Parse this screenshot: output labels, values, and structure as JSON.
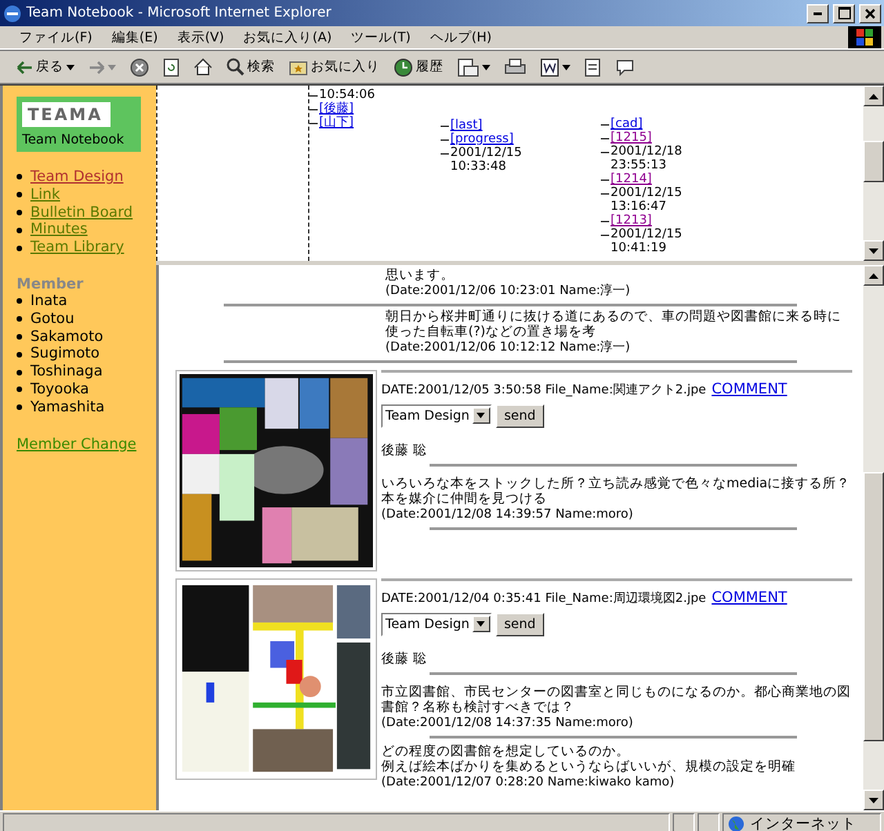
{
  "window": {
    "title": "Team Notebook - Microsoft Internet Explorer"
  },
  "menu": [
    "ファイル(F)",
    "編集(E)",
    "表示(V)",
    "お気に入り(A)",
    "ツール(T)",
    "ヘルプ(H)"
  ],
  "toolbar": {
    "back": "戻る",
    "search": "検索",
    "favorites": "お気に入り",
    "history": "履歴"
  },
  "sidebar": {
    "logo": "TEAMA",
    "subtitle": "Team Notebook",
    "nav": [
      {
        "label": "Team Design",
        "visited": true
      },
      {
        "label": "Link",
        "visited": false
      },
      {
        "label": "Bulletin Board",
        "visited": false
      },
      {
        "label": "Minutes",
        "visited": false
      },
      {
        "label": "Team Library",
        "visited": false
      }
    ],
    "member_heading": "Member",
    "members": [
      "Inata",
      "Gotou",
      "Sakamoto",
      "Sugimoto",
      "Toshinaga",
      "Toyooka",
      "Yamashita"
    ],
    "member_change": "Member Change"
  },
  "tree": {
    "columns": [
      [
        {
          "kind": "text",
          "text": "10:54:06"
        },
        {
          "kind": "link",
          "text": "[後藤]"
        },
        {
          "kind": "link",
          "text": "[山下]"
        }
      ],
      [
        {
          "kind": "link",
          "text": "[last]"
        },
        {
          "kind": "link",
          "text": "[progress]"
        },
        {
          "kind": "text",
          "text": "2001/12/15"
        },
        {
          "kind": "text",
          "text": "10:33:48"
        }
      ],
      [
        {
          "kind": "link",
          "text": "[cad]"
        },
        {
          "kind": "visited",
          "text": "[1215]"
        },
        {
          "kind": "text",
          "text": "2001/12/18"
        },
        {
          "kind": "text",
          "text": "23:55:13"
        },
        {
          "kind": "visited",
          "text": "[1214]"
        },
        {
          "kind": "text",
          "text": "2001/12/15"
        },
        {
          "kind": "text",
          "text": "13:16:47"
        },
        {
          "kind": "visited",
          "text": "[1213]"
        },
        {
          "kind": "text",
          "text": "2001/12/15"
        },
        {
          "kind": "text",
          "text": "10:41:19"
        }
      ]
    ]
  },
  "earlier_comments": [
    {
      "text": "思います。",
      "meta": "(Date:2001/12/06 10:23:01 Name:淳一)"
    },
    {
      "text": "朝日から桜井町通りに抜ける道にあるので、車の問題や図書館に来る時に使った自転車(?)などの置き場を考",
      "meta": "(Date:2001/12/06 10:12:12 Name:淳一)"
    }
  ],
  "posts": [
    {
      "kind": "picture",
      "date": "DATE:2001/12/05 3:50:58 File_Name:関連アクト2.jpe",
      "comment_link": "COMMENT",
      "team": "Team Design",
      "send": "send",
      "author": "後藤 聡",
      "comments": [
        {
          "text": "いろいろな本をストックした所？立ち読み感覚で色々なmediaに接する所？本を媒介に仲間を見つける",
          "meta": "(Date:2001/12/08 14:39:57 Name:moro)"
        }
      ]
    },
    {
      "kind": "picture",
      "date": "DATE:2001/12/04 0:35:41 File_Name:周辺環境図2.jpe",
      "comment_link": "COMMENT",
      "team": "Team Design",
      "send": "send",
      "author": "後藤 聡",
      "comments": [
        {
          "text": "市立図書館、市民センターの図書室と同じものになるのか。都心商業地の図書館？名称も検討すべきでは？",
          "meta": "(Date:2001/12/08 14:37:35 Name:moro)"
        },
        {
          "lines": [
            "どの程度の図書館を想定しているのか。",
            "例えば絵本ばかりを集めるというならばいいが、規模の設定を明確"
          ],
          "meta": "(Date:2001/12/07 0:28:20 Name:kiwako kamo)"
        }
      ]
    }
  ],
  "status_bar": {
    "zone": "インターネット"
  }
}
